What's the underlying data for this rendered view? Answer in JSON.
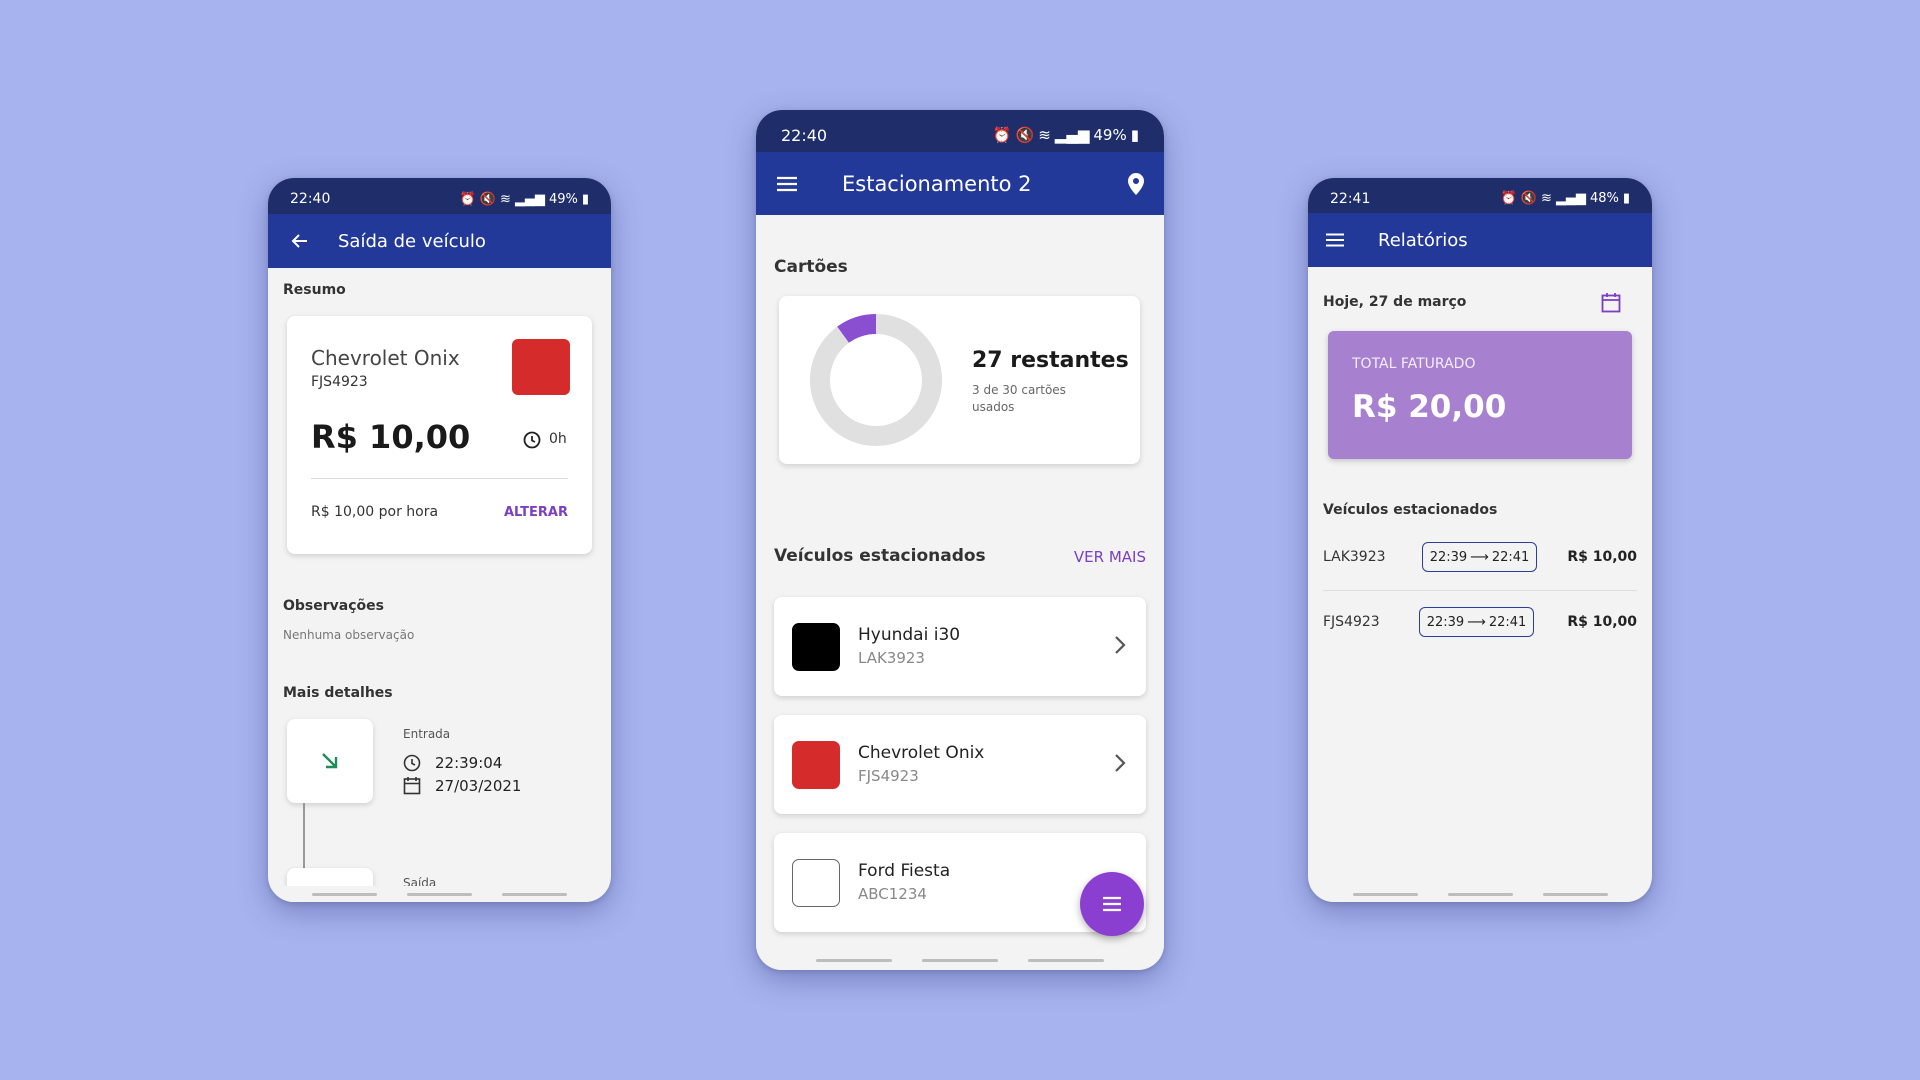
{
  "colors": {
    "background": "#a6b3ee",
    "status_bar": "#1f2e6b",
    "app_bar": "#23399a",
    "accent_purple": "#7b3fc4",
    "fab": "#8a3fd1",
    "red_car": "#d62b2b",
    "black_car": "#000000",
    "white_car": "#ffffff",
    "total_card": "#a880d0",
    "entry_arrow": "#1f8c5a"
  },
  "left_phone": {
    "status": {
      "time": "22:40",
      "battery": "49%"
    },
    "appbar": {
      "back_icon": "arrow-left-icon",
      "title": "Saída de veículo"
    },
    "summary_label": "Resumo",
    "car": {
      "model": "Chevrolet Onix",
      "plate": "FJS4923",
      "price": "R$ 10,00",
      "duration": "0h",
      "rate": "R$ 10,00 por hora",
      "change_label": "ALTERAR"
    },
    "observations_label": "Observações",
    "observations_value": "Nenhuma observação",
    "details_label": "Mais detalhes",
    "entry": {
      "label": "Entrada",
      "time": "22:39:04",
      "date": "27/03/2021"
    },
    "exit_label": "Saída"
  },
  "center_phone": {
    "status": {
      "time": "22:40",
      "battery": "49%"
    },
    "appbar": {
      "menu_icon": "menu-icon",
      "title": "Estacionamento 2",
      "location_icon": "location-pin-icon"
    },
    "cards_label": "Cartões",
    "cards": {
      "remaining": "27 restantes",
      "used_text": "3 de 30 cartões usados",
      "used": 3,
      "total": 30
    },
    "parked_label": "Veículos estacionados",
    "see_more": "VER MAIS",
    "vehicles": [
      {
        "model": "Hyundai i30",
        "plate": "LAK3923",
        "color": "#000000"
      },
      {
        "model": "Chevrolet Onix",
        "plate": "FJS4923",
        "color": "#d62b2b"
      },
      {
        "model": "Ford Fiesta",
        "plate": "ABC1234",
        "color": "#ffffff"
      }
    ],
    "fab_icon": "menu-icon"
  },
  "right_phone": {
    "status": {
      "time": "22:41",
      "battery": "48%"
    },
    "appbar": {
      "menu_icon": "menu-icon",
      "title": "Relatórios"
    },
    "date_label": "Hoje, 27 de março",
    "calendar_icon": "calendar-icon",
    "total_label": "TOTAL FATURADO",
    "total_value": "R$ 20,00",
    "parked_label": "Veículos estacionados",
    "rows": [
      {
        "plate": "LAK3923",
        "start": "22:39",
        "end": "22:41",
        "price": "R$ 10,00"
      },
      {
        "plate": "FJS4923",
        "start": "22:39",
        "end": "22:41",
        "price": "R$ 10,00"
      }
    ]
  }
}
